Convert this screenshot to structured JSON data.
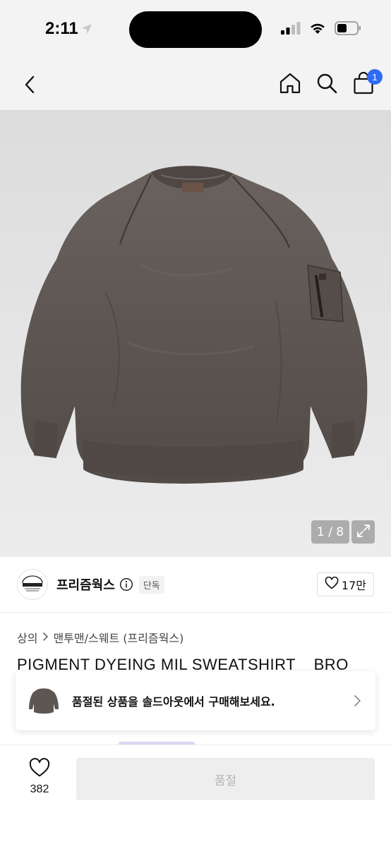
{
  "status_bar": {
    "time": "2:11",
    "icons": [
      "location-arrow-icon",
      "cellular-signal-icon",
      "wifi-icon",
      "battery-icon"
    ]
  },
  "nav": {
    "icons": [
      "back-chevron-icon",
      "home-icon",
      "search-icon",
      "shopping-bag-icon"
    ],
    "cart_count": "1"
  },
  "gallery": {
    "counter": "1 / 8",
    "image_subject": "brown pigment-dyed crewneck sweatshirt with sleeve zip pocket",
    "colors": {
      "sweatshirt": "#5d5652",
      "background": "#e2e2e2"
    }
  },
  "brand": {
    "name": "프리즘웍스",
    "badge": "단독",
    "like_count": "17만"
  },
  "breadcrumb": {
    "items": [
      "상의",
      "맨투맨/스웨트 (프리즘웍스)"
    ]
  },
  "product": {
    "title": "PIGMENT DYEING MIL SWEATSHIRT _ BRO"
  },
  "soldout_banner": {
    "text": "품절된 상품을 솔드아웃에서 구매해보세요."
  },
  "bottom_bar": {
    "wish_count": "382",
    "cta_label": "품절"
  },
  "colors": {
    "accent": "#2f6cf6",
    "disabled_button_bg": "#eeeeee",
    "disabled_button_text": "#b5b5b5"
  }
}
